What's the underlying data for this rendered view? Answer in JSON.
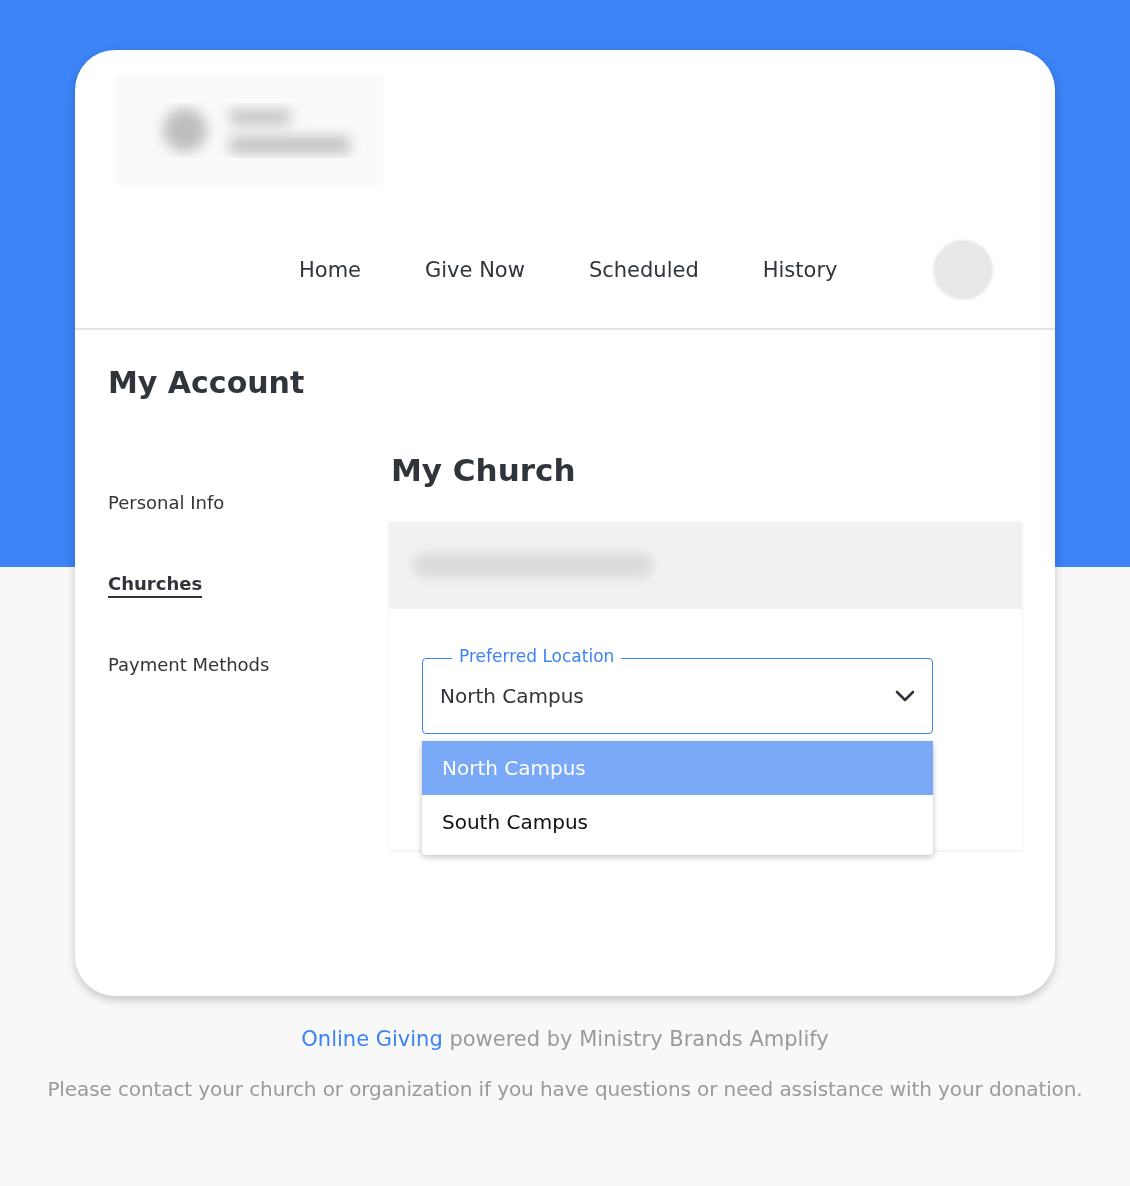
{
  "nav": {
    "items": [
      {
        "label": "Home"
      },
      {
        "label": "Give Now"
      },
      {
        "label": "Scheduled"
      },
      {
        "label": "History"
      }
    ]
  },
  "page_title": "My Account",
  "sidebar": {
    "items": [
      {
        "label": "Personal Info",
        "selected": false
      },
      {
        "label": "Churches",
        "selected": true
      },
      {
        "label": "Payment Methods",
        "selected": false
      }
    ]
  },
  "section_title": "My Church",
  "location_field": {
    "label": "Preferred Location",
    "value": "North Campus",
    "expanded": true,
    "options": [
      {
        "label": "North Campus",
        "selected": true
      },
      {
        "label": "South Campus",
        "selected": false
      }
    ]
  },
  "footer": {
    "link": "Online Giving",
    "text": "powered by Ministry Brands Amplify",
    "note": "Please contact your church or organization if you have questions or need assistance with your donation."
  }
}
